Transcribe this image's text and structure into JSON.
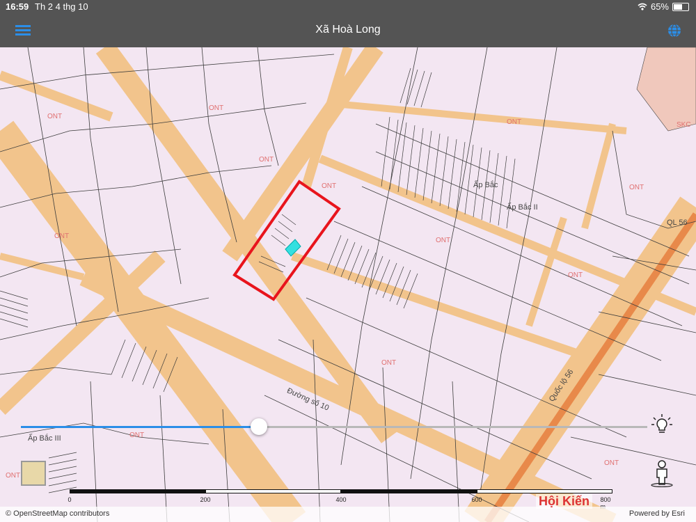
{
  "status_bar": {
    "time": "16:59",
    "date": "Th 2 4 thg 10",
    "battery": "65%",
    "battery_level": 0.65
  },
  "navbar": {
    "title": "Xã Hoà Long",
    "menu_icon": "hamburger-menu-icon",
    "globe_icon": "globe-icon"
  },
  "map": {
    "zone_labels": [
      "ONT",
      "ONT",
      "ONT",
      "ONT",
      "ONT",
      "ONT",
      "ONT",
      "ONT",
      "ONT",
      "ONT",
      "ONT",
      "SKC",
      "ONT",
      "ONT"
    ],
    "place_labels": [
      "Ấp Bắc",
      "Ấp Bắc II",
      "Ấp Bắc III"
    ],
    "road_labels": [
      "Đường số 10",
      "Quốc lộ 56",
      "QL 56"
    ]
  },
  "slider": {
    "value": 0.38
  },
  "scale_bar": {
    "ticks": [
      "0",
      "200",
      "400",
      "600",
      "800 m"
    ]
  },
  "attribution": {
    "left": "© OpenStreetMap contributors",
    "right": "Powered by Esri"
  },
  "watermark": "Hội Kiến",
  "colors": {
    "accent": "#2b8ee8",
    "highlight": "#e8141c",
    "selected_parcel": "#33e0e0",
    "land_fill": "#f3e6f2",
    "road_fill": "#f2c48c"
  }
}
